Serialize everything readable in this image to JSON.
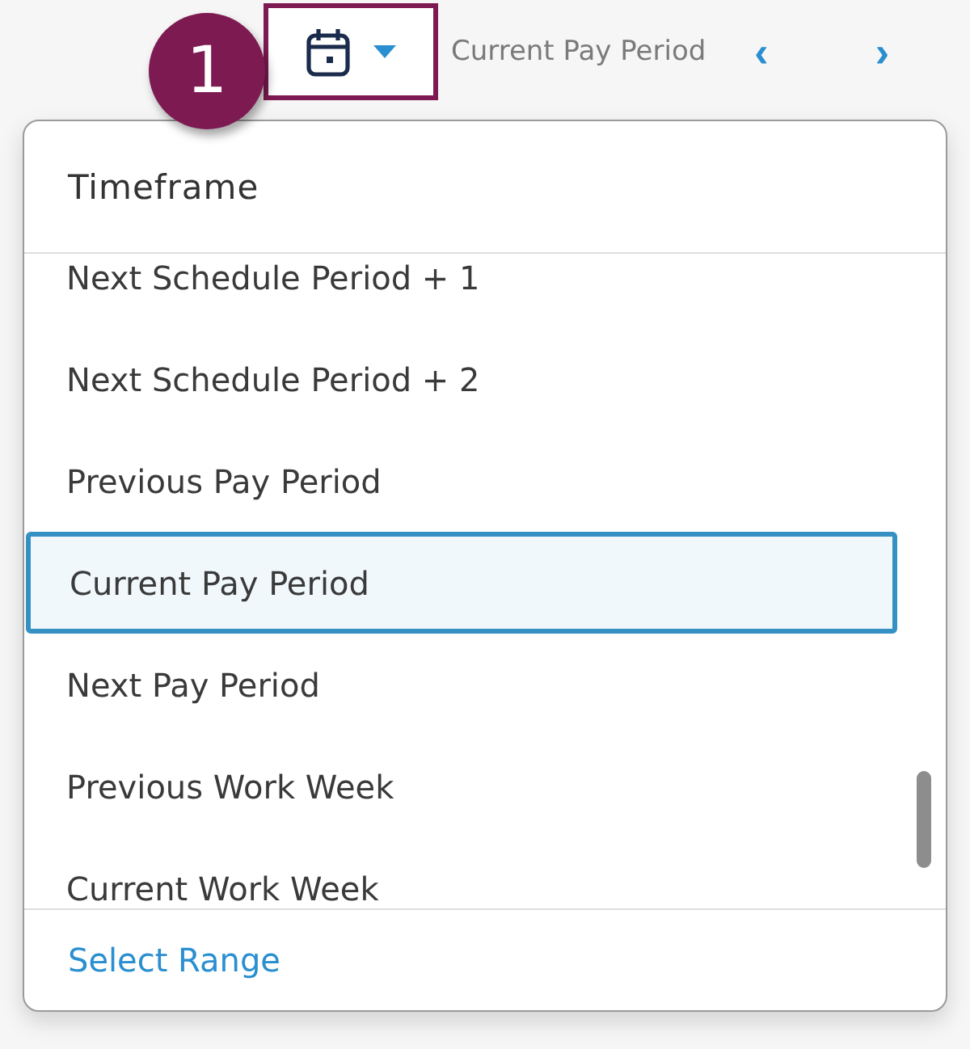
{
  "step_badge": "1",
  "toolbar": {
    "calendar_button": {
      "selected": true
    },
    "current_label": "Current Pay Period",
    "prev": "‹",
    "next": "›"
  },
  "dropdown": {
    "title": "Timeframe",
    "items": [
      {
        "label": "Next Schedule Period + 1",
        "selected": false
      },
      {
        "label": "Next Schedule Period + 2",
        "selected": false
      },
      {
        "label": "Previous Pay Period",
        "selected": false
      },
      {
        "label": "Current Pay Period",
        "selected": true
      },
      {
        "label": "Next Pay Period",
        "selected": false
      },
      {
        "label": "Previous Work Week",
        "selected": false
      },
      {
        "label": "Current Work Week",
        "selected": false
      }
    ],
    "footer_link": "Select Range"
  }
}
